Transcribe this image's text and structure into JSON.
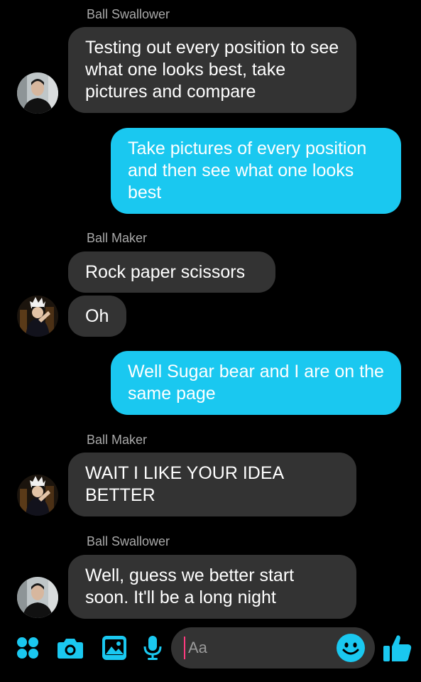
{
  "colors": {
    "accent": "#1ac8f0",
    "incoming_bubble": "#333333",
    "background": "#000000"
  },
  "messages": [
    {
      "sender": "Ball Swallower",
      "text": "Testing out every position to see what one looks best, take pictures and compare"
    },
    {
      "text": "Take pictures of every position and then see what one looks best"
    },
    {
      "sender": "Ball Maker",
      "text": "Rock paper scissors"
    },
    {
      "text": "Oh"
    },
    {
      "text": "Well Sugar bear and I are on the same page"
    },
    {
      "sender": "Ball Maker",
      "text": "WAIT I LIKE YOUR IDEA BETTER"
    },
    {
      "sender": "Ball Swallower",
      "text": "Well, guess we better start soon.  It'll be a long night"
    }
  ],
  "composer": {
    "placeholder": "Aa",
    "icons": [
      "apps-icon",
      "camera-icon",
      "gallery-icon",
      "microphone-icon",
      "emoji-icon",
      "thumbs-up-icon"
    ]
  }
}
